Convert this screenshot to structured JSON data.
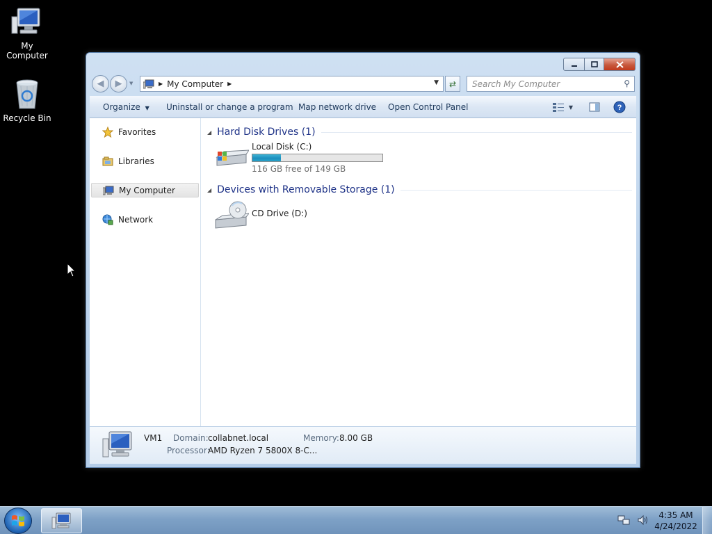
{
  "desktop": {
    "icons": [
      {
        "label": "My Computer"
      },
      {
        "label": "Recycle Bin"
      }
    ]
  },
  "window": {
    "address": {
      "segments": [
        "My Computer"
      ]
    },
    "search": {
      "placeholder": "Search My Computer"
    },
    "toolbar": {
      "organize": "Organize",
      "uninstall": "Uninstall or change a program",
      "map_drive": "Map network drive",
      "control_panel": "Open Control Panel"
    },
    "nav_pane": {
      "items": [
        {
          "label": "Favorites"
        },
        {
          "label": "Libraries"
        },
        {
          "label": "My Computer",
          "selected": true
        },
        {
          "label": "Network"
        }
      ]
    },
    "groups": [
      {
        "title": "Hard Disk Drives (1)",
        "items": [
          {
            "name": "Local Disk (C:)",
            "free_text": "116 GB free of 149 GB",
            "used_fraction": 0.22
          }
        ]
      },
      {
        "title": "Devices with Removable Storage (1)",
        "items": [
          {
            "name": "CD Drive (D:)"
          }
        ]
      }
    ],
    "details": {
      "computer_name": "VM1",
      "domain_label": "Domain:",
      "domain_value": "collabnet.local",
      "memory_label": "Memory:",
      "memory_value": "8.00 GB",
      "processor_label": "Processor:",
      "processor_value": "AMD Ryzen 7 5800X 8-C..."
    }
  },
  "taskbar": {
    "clock": {
      "time": "4:35 AM",
      "date": "4/24/2022"
    }
  },
  "colors": {
    "accent_header": "#1e3287",
    "close_button": "#c23a1c",
    "disk_bar_fill": "#26a2c9"
  }
}
